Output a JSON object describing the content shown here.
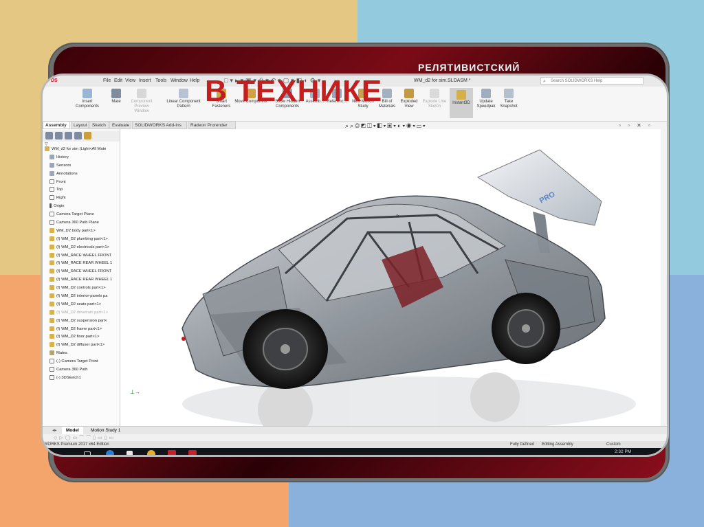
{
  "colors": {
    "bg_top_left": "#e5c784",
    "bg_top_right": "#93cadd",
    "bg_bottom_left": "#f4a56b",
    "bg_bottom_right": "#8ab0dc",
    "title_red": "#c41f1f"
  },
  "banner": "РЕЛЯТИВИСТСКИЙ",
  "overlay_title": "В ТЕХНИКЕ",
  "menu": [
    "File",
    "Edit",
    "View",
    "Insert",
    "Tools",
    "Window",
    "Help"
  ],
  "doc_title": "WM_d2 for sim.SLDASM *",
  "search_placeholder": "Search SOLIDWORKS Help",
  "ribbon": [
    {
      "label": "Insert Components",
      "state": "normal"
    },
    {
      "label": "Mate",
      "state": "normal"
    },
    {
      "label": "Component Preview Window",
      "state": "dim"
    },
    {
      "label": "Linear Component Pattern",
      "state": "normal"
    },
    {
      "label": "Smart Fasteners",
      "state": "normal"
    },
    {
      "label": "Move Component",
      "state": "normal"
    },
    {
      "label": "Show Hidden Components",
      "state": "normal"
    },
    {
      "label": "Assemb...",
      "state": "normal"
    },
    {
      "label": "Referenc...",
      "state": "normal"
    },
    {
      "label": "New Motion Study",
      "state": "normal"
    },
    {
      "label": "Bill of Materials",
      "state": "normal"
    },
    {
      "label": "Exploded View",
      "state": "normal"
    },
    {
      "label": "Explode Line Sketch",
      "state": "dim"
    },
    {
      "label": "Instant3D",
      "state": "active"
    },
    {
      "label": "Update Speedpak",
      "state": "normal"
    },
    {
      "label": "Take Snapshot",
      "state": "normal"
    }
  ],
  "tabs": [
    "Assembly",
    "Layout",
    "Sketch",
    "Evaluate",
    "SOLIDWORKS Add-Ins",
    "Radeon Prorender"
  ],
  "tree": [
    {
      "label": "WM_d2 for sim  (Light<All Mate",
      "icon": "part",
      "dim": false
    },
    {
      "label": "History",
      "icon": "folder",
      "dim": false
    },
    {
      "label": "Sensors",
      "icon": "folder",
      "dim": false
    },
    {
      "label": "Annotations",
      "icon": "folder",
      "dim": false
    },
    {
      "label": "Front",
      "icon": "plane",
      "dim": false
    },
    {
      "label": "Top",
      "icon": "plane",
      "dim": false
    },
    {
      "label": "Right",
      "icon": "plane",
      "dim": false
    },
    {
      "label": "Origin",
      "icon": "origin",
      "dim": false
    },
    {
      "label": "Camera Target Plane",
      "icon": "plane",
      "dim": false
    },
    {
      "label": "Camera 360 Path Plane",
      "icon": "plane",
      "dim": false
    },
    {
      "label": "WM_D2 body part<1>",
      "icon": "part",
      "dim": false
    },
    {
      "label": "(f) WM_D2 plumbing part<1>",
      "icon": "part",
      "dim": false
    },
    {
      "label": "(f) WM_D2 electricals part<1>",
      "icon": "part",
      "dim": false
    },
    {
      "label": "(f) WM_RACE WHEEL FRONT",
      "icon": "part",
      "dim": false
    },
    {
      "label": "(f) WM_RACE REAR WHEEL 1",
      "icon": "part",
      "dim": false
    },
    {
      "label": "(f) WM_RACE WHEEL FRONT",
      "icon": "part",
      "dim": false
    },
    {
      "label": "(f) WM_RACE REAR WHEEL 1",
      "icon": "part",
      "dim": false
    },
    {
      "label": "(f) WM_D2 controls part<1>",
      "icon": "part",
      "dim": false
    },
    {
      "label": "(f) WM_D2 interior-panels pa",
      "icon": "part",
      "dim": false
    },
    {
      "label": "(f) WM_D2 seats part<1>",
      "icon": "part",
      "dim": false
    },
    {
      "label": "(f) WM_D2 drivetrain part<1>",
      "icon": "part",
      "dim": true
    },
    {
      "label": "(f) WM_D2 suspension part<",
      "icon": "part",
      "dim": false
    },
    {
      "label": "(f) WM_D2 frame part<1>",
      "icon": "part",
      "dim": false
    },
    {
      "label": "(f) WM_D2 floor part<1>",
      "icon": "part",
      "dim": false
    },
    {
      "label": "(f) WM_D2 diffuser part<1>",
      "icon": "part",
      "dim": false
    },
    {
      "label": "Mates",
      "icon": "mate",
      "dim": false
    },
    {
      "label": "(-) Camera Target Point",
      "icon": "plane",
      "dim": false
    },
    {
      "label": "Camera 360 Path",
      "icon": "plane",
      "dim": false
    },
    {
      "label": "(-) 3DSketch1",
      "icon": "plane",
      "dim": false
    }
  ],
  "bottom_tabs": [
    "Model",
    "Motion Study 1"
  ],
  "status": {
    "left": "WORKS Premium 2017 x64 Edition",
    "defined": "Fully Defined",
    "mode": "Editing Assembly",
    "units": "Custom"
  },
  "clock": {
    "time": "2:32 PM"
  },
  "car": {
    "spoiler_text": "PRO"
  }
}
